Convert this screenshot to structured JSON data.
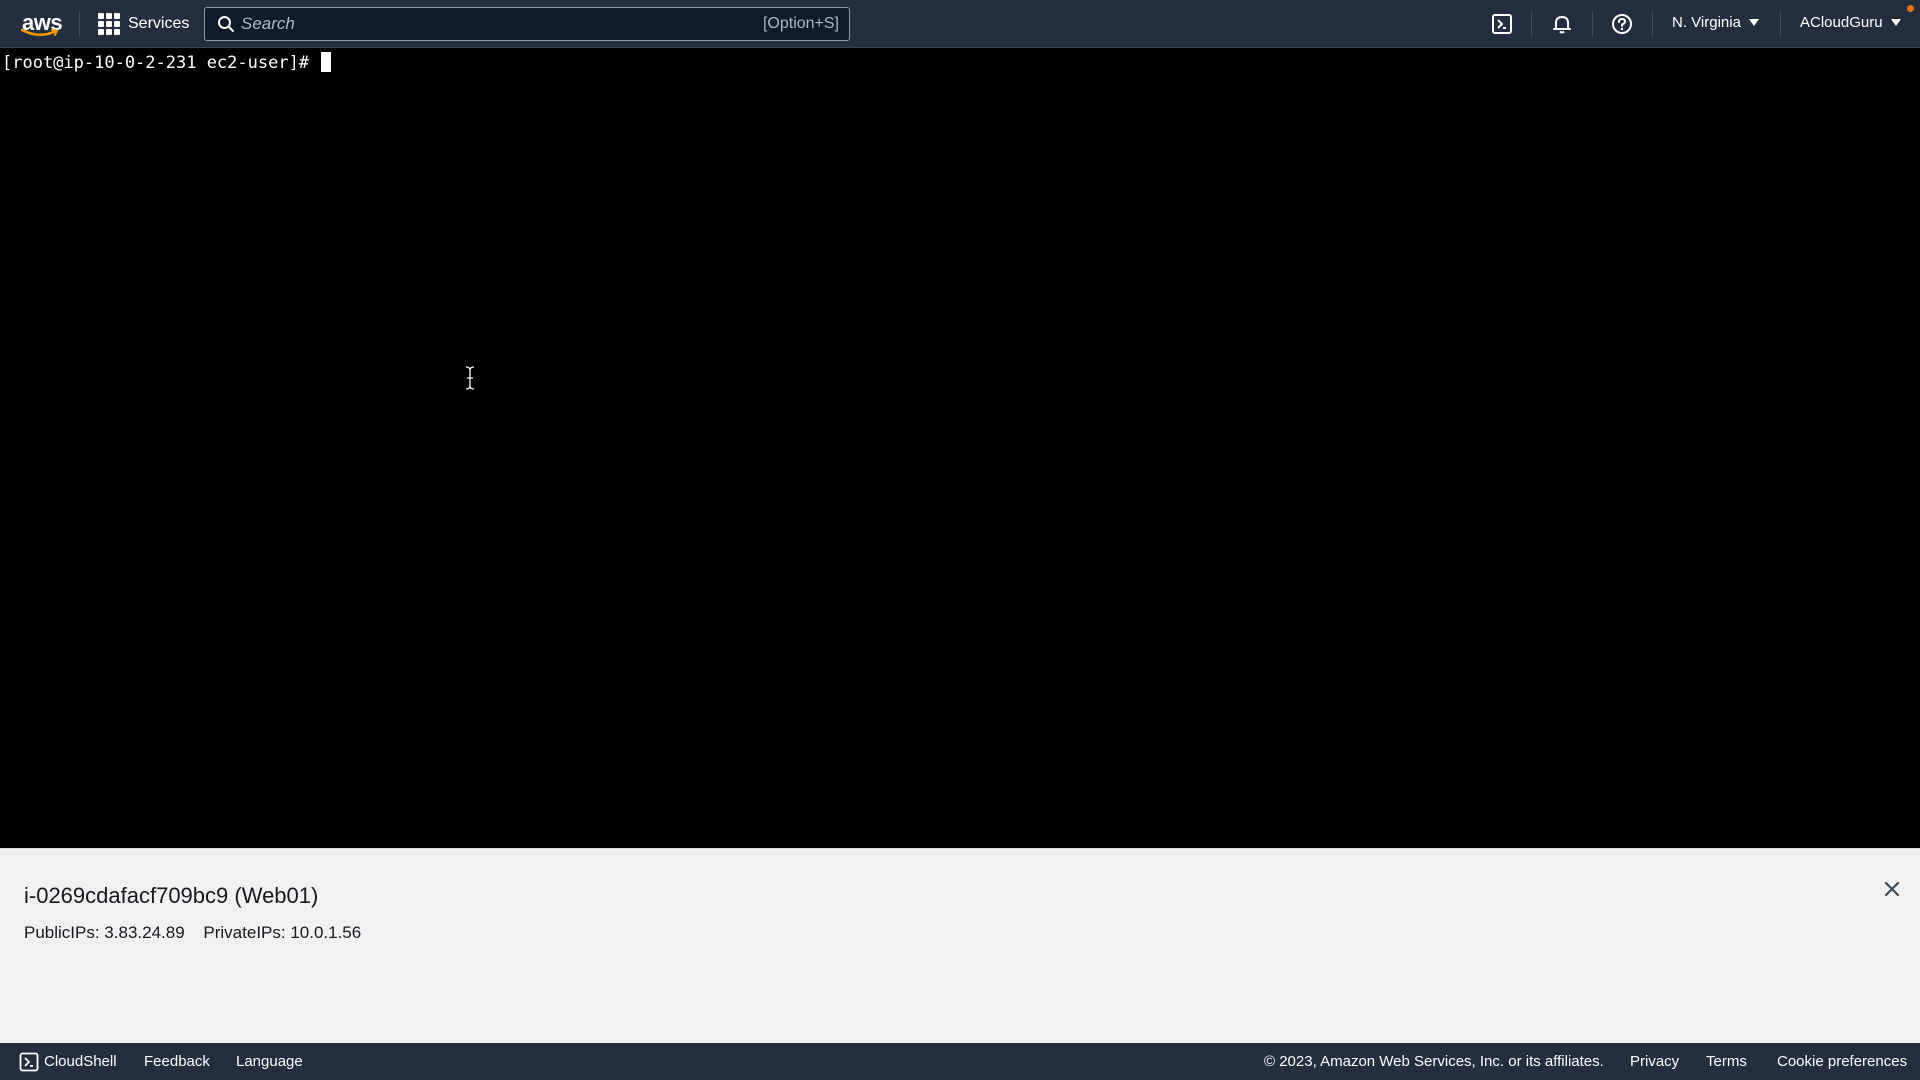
{
  "header": {
    "logo_text": "aws",
    "services_label": "Services",
    "search": {
      "placeholder": "Search",
      "shortcut": "[Option+S]"
    },
    "icons": [
      "cloudshell-icon",
      "bell-icon",
      "help-icon"
    ],
    "region": "N. Virginia",
    "account": "ACloudGuru"
  },
  "terminal": {
    "prompt": "[root@ip-10-0-2-231 ec2-user]# "
  },
  "instance": {
    "title": "i-0269cdafacf709bc9 (Web01)",
    "public_ips": "PublicIPs: 3.83.24.89",
    "private_ips": "PrivateIPs: 10.0.1.56"
  },
  "footer": {
    "cloudshell": "CloudShell",
    "feedback": "Feedback",
    "language": "Language",
    "copyright": "© 2023, Amazon Web Services, Inc. or its affiliates.",
    "privacy": "Privacy",
    "terms": "Terms",
    "cookie": "Cookie preferences"
  },
  "colors": {
    "nav_bg": "#232f3e",
    "terminal_bg": "#000000",
    "panel_bg": "#f1f1f1",
    "notification_dot": "#ec7211",
    "logo_smile": "#ff9900"
  }
}
